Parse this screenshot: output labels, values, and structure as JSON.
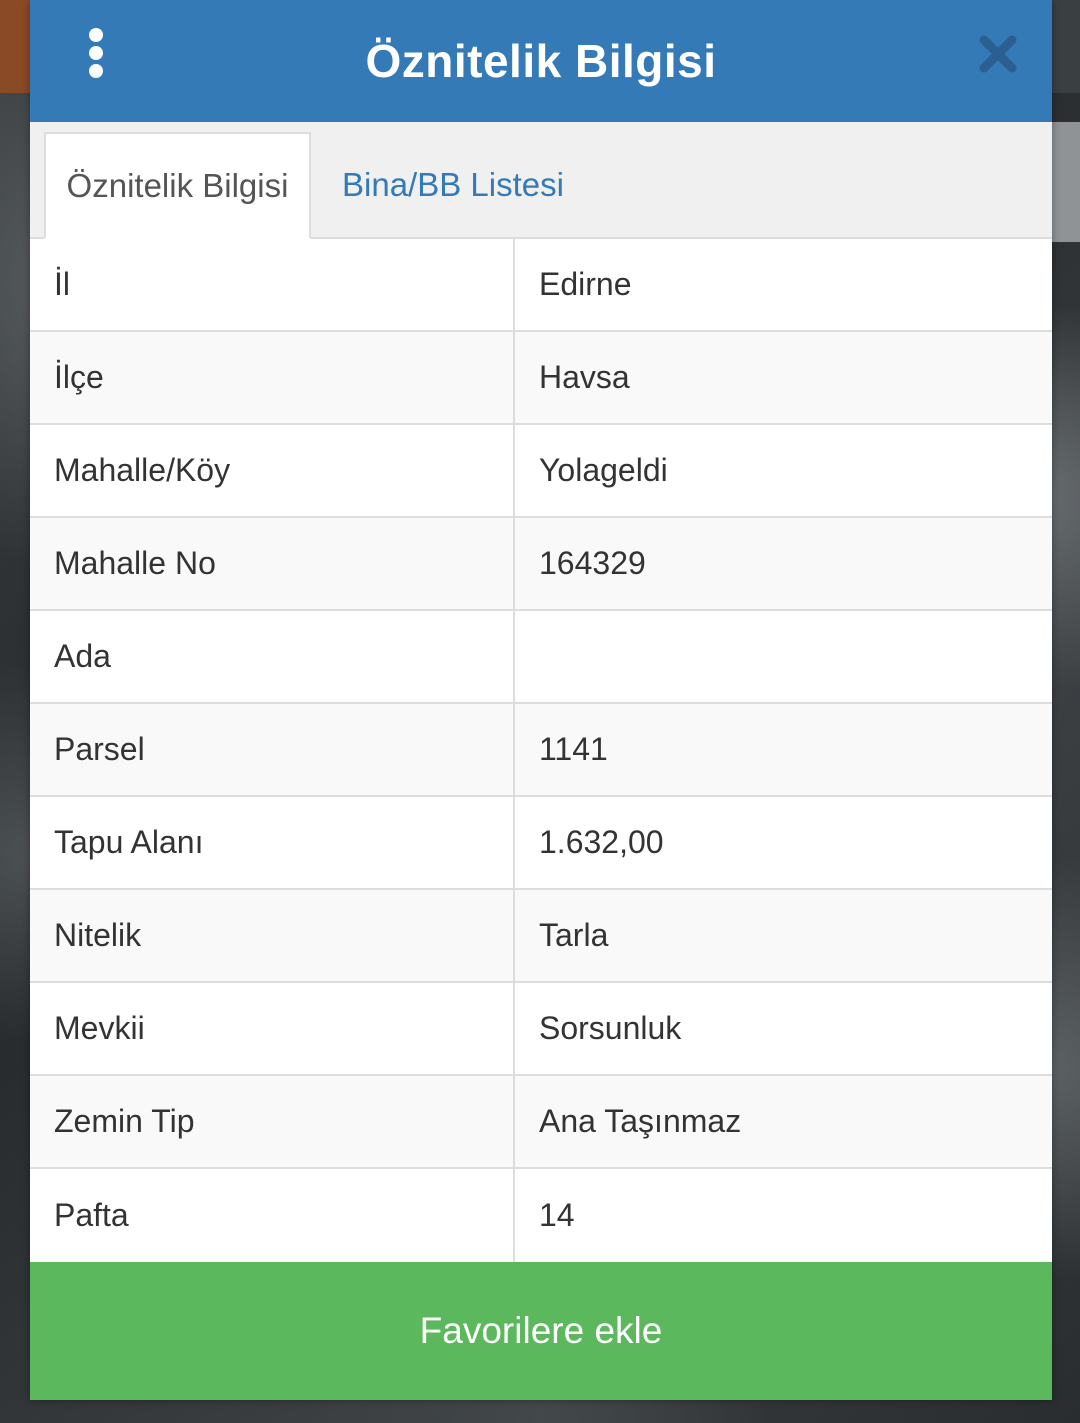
{
  "dialog": {
    "title": "Öznitelik Bilgisi"
  },
  "tabs": [
    {
      "label": "Öznitelik Bilgisi",
      "active": true
    },
    {
      "label": "Bina/BB Listesi",
      "active": false
    }
  ],
  "attributes": [
    {
      "key": "İl",
      "value": "Edirne"
    },
    {
      "key": "İlçe",
      "value": "Havsa"
    },
    {
      "key": "Mahalle/Köy",
      "value": "Yolageldi"
    },
    {
      "key": "Mahalle No",
      "value": "164329"
    },
    {
      "key": "Ada",
      "value": ""
    },
    {
      "key": "Parsel",
      "value": "1141"
    },
    {
      "key": "Tapu Alanı",
      "value": "1.632,00"
    },
    {
      "key": "Nitelik",
      "value": "Tarla"
    },
    {
      "key": "Mevkii",
      "value": "Sorsunluk"
    },
    {
      "key": "Zemin Tip",
      "value": "Ana Taşınmaz"
    },
    {
      "key": "Pafta",
      "value": "14"
    }
  ],
  "footer": {
    "button_label": "Favorilere ekle"
  },
  "colors": {
    "header": "#337ab7",
    "footer_button": "#5cb85c",
    "close_icon": "#2a5f8f"
  },
  "icons": {
    "menu": "vertical-dots-icon",
    "close": "close-icon"
  }
}
